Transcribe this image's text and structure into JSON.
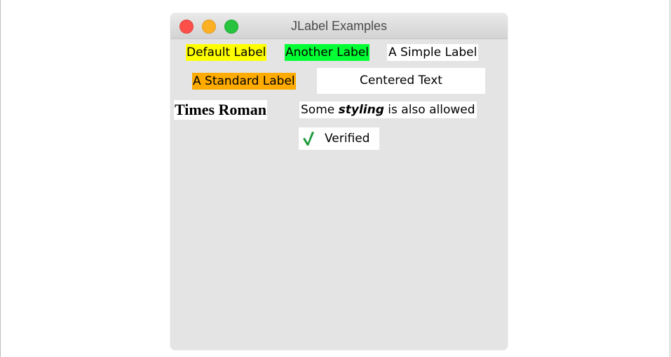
{
  "window": {
    "title": "JLabel Examples"
  },
  "labels": {
    "default": "Default Label",
    "another": "Another Label",
    "simple": "A Simple Label",
    "standard": "A Standard Label",
    "centered": "Centered Text",
    "times": "Times Roman",
    "styling_before": "Some ",
    "styling_emph": "styling",
    "styling_after": " is also allowed",
    "verified": "Verified"
  },
  "colors": {
    "default_bg": "#ffff00",
    "another_bg": "#00ff33",
    "standard_bg": "#ffab00",
    "check_color": "#1e9a3a"
  },
  "icons": {
    "verified": "check-icon"
  }
}
